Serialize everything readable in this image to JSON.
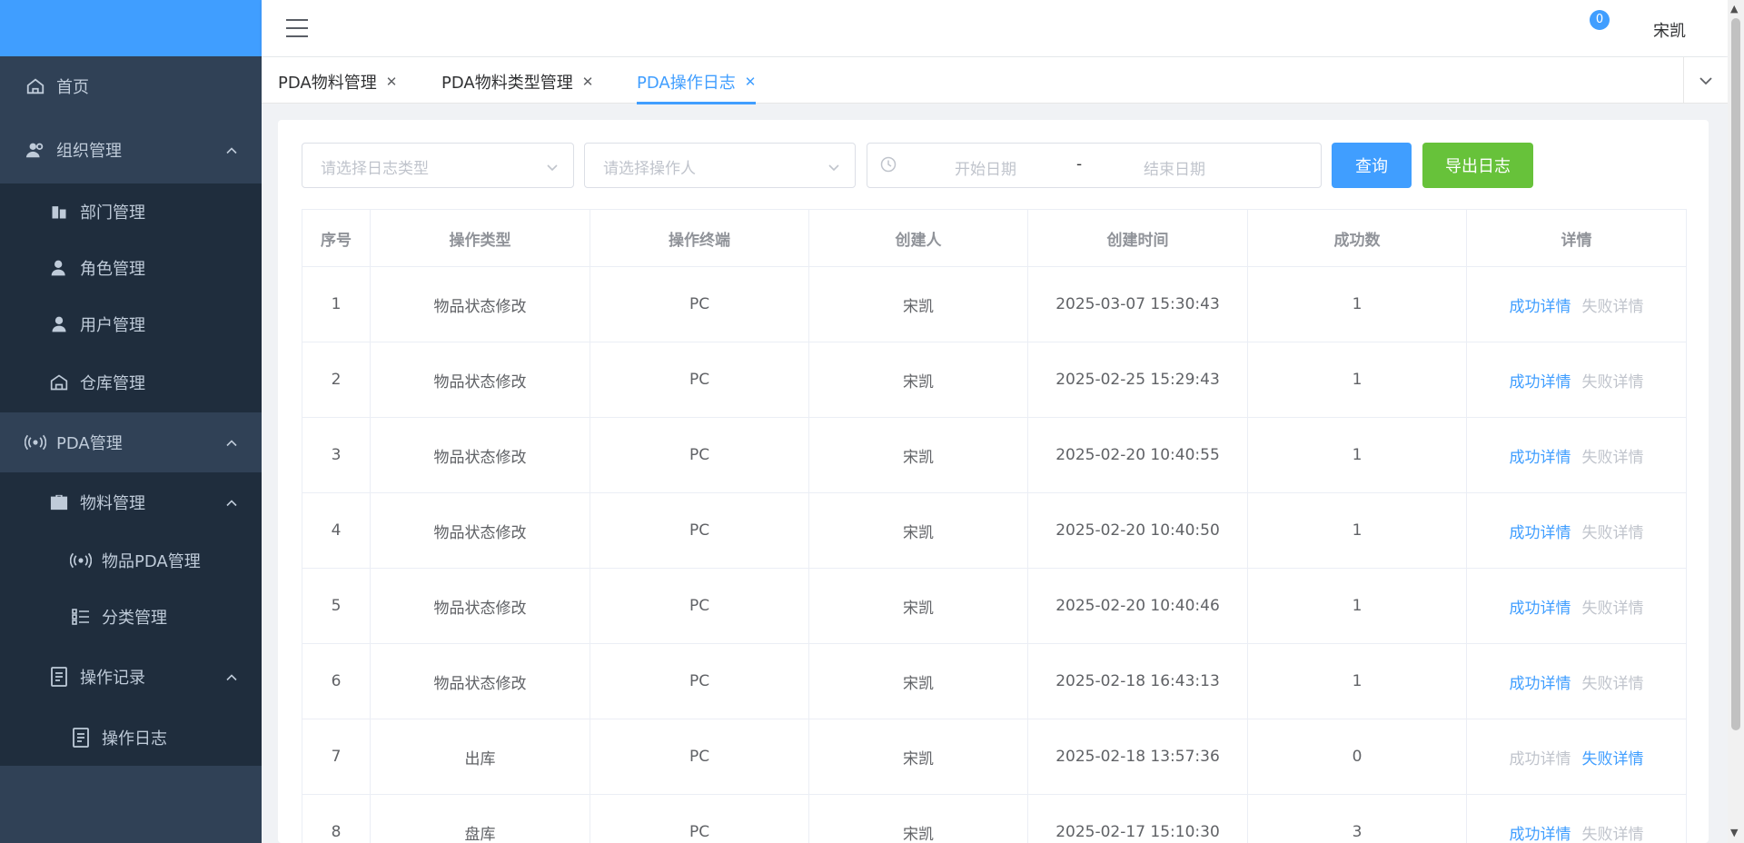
{
  "sidebar": {
    "items": [
      {
        "label": "首页",
        "icon": "home-icon",
        "level": 1
      },
      {
        "label": "组织管理",
        "icon": "users-icon",
        "level": 1,
        "expanded": true
      },
      {
        "label": "部门管理",
        "icon": "building-icon",
        "level": 2
      },
      {
        "label": "角色管理",
        "icon": "user-role-icon",
        "level": 2
      },
      {
        "label": "用户管理",
        "icon": "user-icon",
        "level": 2
      },
      {
        "label": "仓库管理",
        "icon": "warehouse-icon",
        "level": 2
      },
      {
        "label": "PDA管理",
        "icon": "broadcast-icon",
        "level": 1,
        "expanded": true
      },
      {
        "label": "物料管理",
        "icon": "briefcase-icon",
        "level": 2,
        "expanded": true
      },
      {
        "label": "物品PDA管理",
        "icon": "broadcast-icon",
        "level": 3
      },
      {
        "label": "分类管理",
        "icon": "list-icon",
        "level": 3
      },
      {
        "label": "操作记录",
        "icon": "document-icon",
        "level": 2,
        "expanded": true
      },
      {
        "label": "操作日志",
        "icon": "document-icon",
        "level": 3
      }
    ]
  },
  "header": {
    "badge_count": "0",
    "username": "宋凯"
  },
  "tags": [
    {
      "label": "PDA物料管理",
      "active": false
    },
    {
      "label": "PDA物料类型管理",
      "active": false
    },
    {
      "label": "PDA操作日志",
      "active": true
    }
  ],
  "filters": {
    "log_type_placeholder": "请选择日志类型",
    "operator_placeholder": "请选择操作人",
    "start_date_placeholder": "开始日期",
    "date_separator": "-",
    "end_date_placeholder": "结束日期",
    "query_label": "查询",
    "export_label": "导出日志"
  },
  "table": {
    "columns": [
      "序号",
      "操作类型",
      "操作终端",
      "创建人",
      "创建时间",
      "成功数",
      "详情"
    ],
    "success_detail_label": "成功详情",
    "fail_detail_label": "失败详情",
    "rows": [
      {
        "no": "1",
        "type": "物品状态修改",
        "terminal": "PC",
        "creator": "宋凯",
        "time": "2025-03-07 15:30:43",
        "success": "1"
      },
      {
        "no": "2",
        "type": "物品状态修改",
        "terminal": "PC",
        "creator": "宋凯",
        "time": "2025-02-25 15:29:43",
        "success": "1"
      },
      {
        "no": "3",
        "type": "物品状态修改",
        "terminal": "PC",
        "creator": "宋凯",
        "time": "2025-02-20 10:40:55",
        "success": "1"
      },
      {
        "no": "4",
        "type": "物品状态修改",
        "terminal": "PC",
        "creator": "宋凯",
        "time": "2025-02-20 10:40:50",
        "success": "1"
      },
      {
        "no": "5",
        "type": "物品状态修改",
        "terminal": "PC",
        "creator": "宋凯",
        "time": "2025-02-20 10:40:46",
        "success": "1"
      },
      {
        "no": "6",
        "type": "物品状态修改",
        "terminal": "PC",
        "creator": "宋凯",
        "time": "2025-02-18 16:43:13",
        "success": "1"
      },
      {
        "no": "7",
        "type": "出库",
        "terminal": "PC",
        "creator": "宋凯",
        "time": "2025-02-18 13:57:36",
        "success": "0"
      },
      {
        "no": "8",
        "type": "盘库",
        "terminal": "PC",
        "creator": "宋凯",
        "time": "2025-02-17 15:10:30",
        "success": "3"
      }
    ]
  },
  "colors": {
    "sidebar_bg": "#304156",
    "submenu_bg": "#1f2d3d",
    "primary": "#409eff",
    "success": "#67c23a",
    "muted": "#c0c4cc"
  }
}
